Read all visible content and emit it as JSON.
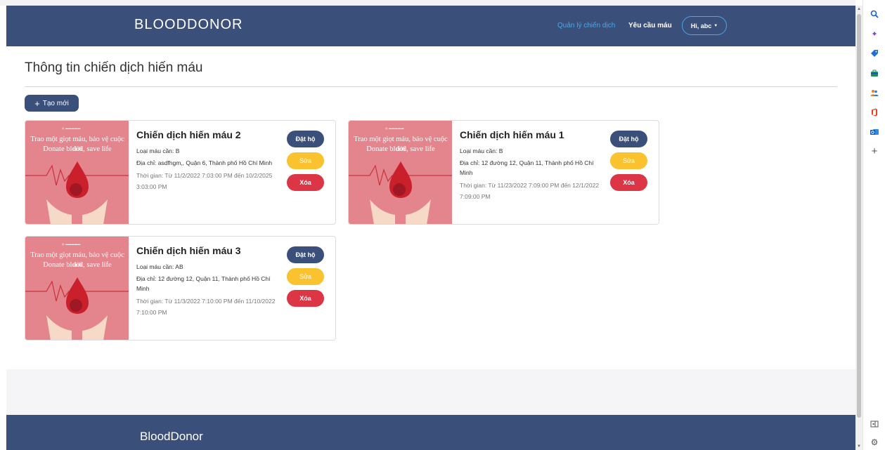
{
  "header": {
    "brand": "BLOODDONOR",
    "nav": [
      "Quản lý chiến dịch",
      "Yêu cầu máu"
    ],
    "user": "Hi, abc"
  },
  "main": {
    "title": "Thông tin chiến dịch hiến máu",
    "create_label": "Tạo mới",
    "buttons": {
      "book": "Đặt hộ",
      "edit": "Sửa",
      "delete": "Xóa"
    },
    "image_text": {
      "line1": "Trao một giọt máu, bảo vệ cuộc đời",
      "line2": "Donate blood, save life"
    },
    "campaigns": [
      {
        "title": "Chiến dịch hiến máu 2",
        "blood": "Loại máu cần: B",
        "address": "Địa chỉ: asdfhgm,, Quận 6, Thành phố Hồ Chí Minh",
        "time": "Thời gian: Từ 11/2/2022 7:03:00 PM đến 10/2/2025 3:03:00 PM"
      },
      {
        "title": "Chiến dịch hiến máu 1",
        "blood": "Loại máu cần: B",
        "address": "Địa chỉ: 12 đường 12, Quận 11, Thành phố Hồ Chí Minh",
        "time": "Thời gian: Từ 11/23/2022 7:09:00 PM đến 12/1/2022 7:09:00 PM"
      },
      {
        "title": "Chiến dịch hiến máu 3",
        "blood": "Loại máu cần: AB",
        "address": "Địa chỉ: 12 đường 12, Quận 11, Thành phố Hồ Chí Minh",
        "time": "Thời gian: Từ 11/3/2022 7:10:00 PM đến 11/10/2022 7:10:00 PM"
      }
    ]
  },
  "footer": {
    "brand": "BloodDonor"
  },
  "colors": {
    "primary": "#3a4f7a",
    "accent": "#4aa8e8",
    "warning": "#f9c22e",
    "danger": "#dc3545",
    "image_bg": "#e4848c"
  },
  "sidebar_icons": [
    "search-icon",
    "sparkle-icon",
    "tag-icon",
    "briefcase-icon",
    "people-icon",
    "office-icon",
    "outlook-icon",
    "add-icon",
    "split-view-icon",
    "settings-icon"
  ]
}
